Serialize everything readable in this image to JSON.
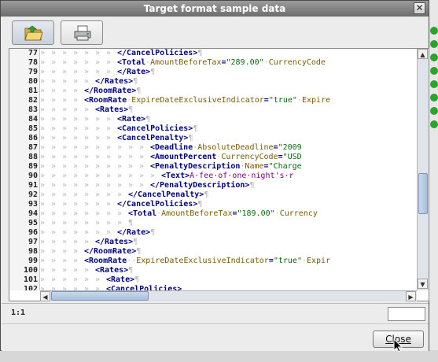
{
  "window": {
    "title": "Target format sample data",
    "close_glyph": "✕"
  },
  "toolbar": {
    "buttons": [
      {
        "name": "open-folder",
        "icon": "folder-open-icon"
      },
      {
        "name": "print",
        "icon": "printer-icon"
      }
    ]
  },
  "editor": {
    "lines": [
      {
        "n": "77",
        "indent": 7,
        "parts": [
          [
            "tag",
            "</CancelPolicies>"
          ],
          [
            "ws",
            "¶"
          ]
        ]
      },
      {
        "n": "78",
        "indent": 7,
        "parts": [
          [
            "tag",
            "<Total"
          ],
          [
            "ws",
            "·"
          ],
          [
            "attr",
            "AmountBeforeTax"
          ],
          [
            "tag",
            "="
          ],
          [
            "val",
            "\"289.00\""
          ],
          [
            "ws",
            "·"
          ],
          [
            "attr",
            "CurrencyCode"
          ]
        ]
      },
      {
        "n": "79",
        "indent": 7,
        "parts": [
          [
            "tag",
            "</Rate>"
          ],
          [
            "ws",
            "¶"
          ]
        ]
      },
      {
        "n": "80",
        "indent": 5,
        "parts": [
          [
            "tag",
            "</Rates>"
          ],
          [
            "ws",
            "¶"
          ]
        ]
      },
      {
        "n": "81",
        "indent": 4,
        "parts": [
          [
            "tag",
            "</RoomRate>"
          ],
          [
            "ws",
            "¶"
          ]
        ]
      },
      {
        "n": "82",
        "indent": 4,
        "parts": [
          [
            "tag",
            "<RoomRate"
          ],
          [
            "ws",
            "·"
          ],
          [
            "attr",
            "ExpireDateExclusiveIndicator"
          ],
          [
            "tag",
            "="
          ],
          [
            "val",
            "\"true\""
          ],
          [
            "ws",
            "·"
          ],
          [
            "attr",
            "Expire"
          ]
        ]
      },
      {
        "n": "83",
        "indent": 5,
        "parts": [
          [
            "tag",
            "<Rates>"
          ],
          [
            "ws",
            "¶"
          ]
        ]
      },
      {
        "n": "84",
        "indent": 7,
        "parts": [
          [
            "tag",
            "<Rate>"
          ],
          [
            "ws",
            "¶"
          ]
        ]
      },
      {
        "n": "85",
        "indent": 7,
        "parts": [
          [
            "tag",
            "<CancelPolicies>"
          ],
          [
            "ws",
            "¶"
          ]
        ]
      },
      {
        "n": "86",
        "indent": 7,
        "parts": [
          [
            "tag",
            "<CancelPenalty>"
          ],
          [
            "ws",
            "¶"
          ]
        ]
      },
      {
        "n": "87",
        "indent": 10,
        "parts": [
          [
            "tag",
            "<Deadline"
          ],
          [
            "ws",
            "·"
          ],
          [
            "attr",
            "AbsoluteDeadline"
          ],
          [
            "tag",
            "="
          ],
          [
            "val",
            "\"2009"
          ]
        ]
      },
      {
        "n": "88",
        "indent": 10,
        "parts": [
          [
            "tag",
            "<AmountPercent"
          ],
          [
            "ws",
            "·"
          ],
          [
            "attr",
            "CurrencyCode"
          ],
          [
            "tag",
            "="
          ],
          [
            "val",
            "\"USD"
          ]
        ]
      },
      {
        "n": "89",
        "indent": 10,
        "parts": [
          [
            "tag",
            "<PenaltyDescription"
          ],
          [
            "ws",
            "·"
          ],
          [
            "attr",
            "Name"
          ],
          [
            "tag",
            "="
          ],
          [
            "val",
            "\"Charge"
          ]
        ]
      },
      {
        "n": "90",
        "indent": 11,
        "parts": [
          [
            "tag",
            "<Text>"
          ],
          [
            "txt",
            "A·fee·of·one·night's·r"
          ]
        ]
      },
      {
        "n": "91",
        "indent": 10,
        "parts": [
          [
            "tag",
            "</PenaltyDescription>"
          ],
          [
            "ws",
            "¶"
          ]
        ]
      },
      {
        "n": "92",
        "indent": 8,
        "parts": [
          [
            "tag",
            "</CancelPenalty>"
          ],
          [
            "ws",
            "¶"
          ]
        ]
      },
      {
        "n": "93",
        "indent": 7,
        "parts": [
          [
            "tag",
            "</CancelPolicies>"
          ],
          [
            "ws",
            "¶"
          ]
        ]
      },
      {
        "n": "94",
        "indent": 8,
        "parts": [
          [
            "tag",
            "<Total"
          ],
          [
            "ws",
            "·"
          ],
          [
            "attr",
            "AmountBeforeTax"
          ],
          [
            "tag",
            "="
          ],
          [
            "val",
            "\"189.00\""
          ],
          [
            "ws",
            "·"
          ],
          [
            "attr",
            "Currency"
          ]
        ]
      },
      {
        "n": "95",
        "indent": 8,
        "parts": [
          [
            "ws",
            "¶"
          ]
        ]
      },
      {
        "n": "96",
        "indent": 7,
        "parts": [
          [
            "tag",
            "</Rate>"
          ],
          [
            "ws",
            "¶"
          ]
        ]
      },
      {
        "n": "97",
        "indent": 5,
        "parts": [
          [
            "tag",
            "</Rates>"
          ],
          [
            "ws",
            "¶"
          ]
        ]
      },
      {
        "n": "98",
        "indent": 4,
        "parts": [
          [
            "tag",
            "</RoomRate>"
          ],
          [
            "ws",
            "¶"
          ]
        ]
      },
      {
        "n": "99",
        "indent": 4,
        "parts": [
          [
            "tag",
            "<RoomRate"
          ],
          [
            "ws",
            "··"
          ],
          [
            "attr",
            "ExpireDateExclusiveIndicator"
          ],
          [
            "tag",
            "="
          ],
          [
            "val",
            "\"true\""
          ],
          [
            "ws",
            "·"
          ],
          [
            "attr",
            "Expir"
          ]
        ]
      },
      {
        "n": "100",
        "indent": 5,
        "parts": [
          [
            "tag",
            "<Rates>"
          ],
          [
            "ws",
            "¶"
          ]
        ]
      },
      {
        "n": "101",
        "indent": 6,
        "parts": [
          [
            "tag",
            "<Rate>"
          ],
          [
            "ws",
            "¶"
          ]
        ]
      },
      {
        "n": "102",
        "indent": 6,
        "parts": [
          [
            "tag",
            "<CancelPolicies>"
          ]
        ]
      }
    ],
    "indent_glyph": "»",
    "scroll": {
      "vertical_arrow_up": "▲",
      "vertical_arrow_down": "▼",
      "horizontal_arrow_left": "◀",
      "horizontal_arrow_right": "▶"
    }
  },
  "status": {
    "position": "1:1"
  },
  "footer": {
    "close_label": "Close"
  },
  "colors": {
    "tag": "#000080",
    "attr": "#7a5a00",
    "value": "#0a6b0a",
    "text": "#7a007a",
    "whitespace": "#b9b9b9"
  }
}
